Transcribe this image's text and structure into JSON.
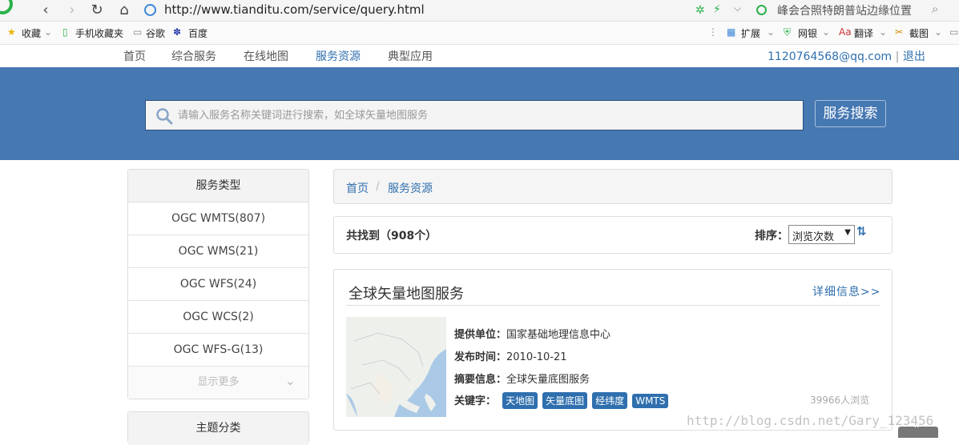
{
  "browser": {
    "url": "http://www.tianditu.com/service/query.html",
    "search_hint": "峰会合照特朗普站边缘位置",
    "bookmarks": [
      "收藏",
      "手机收藏夹",
      "谷歌",
      "百度"
    ],
    "tools": [
      "扩展",
      "网银",
      "翻译",
      "截图"
    ]
  },
  "site_nav": {
    "items": [
      "首页",
      "综合服务",
      "在线地图",
      "服务资源",
      "典型应用"
    ],
    "active": "服务资源",
    "account_email": "1120764568@qq.com",
    "separator": "|",
    "logout": "退出"
  },
  "search": {
    "placeholder": "请输入服务名称关键词进行搜索，如全球矢量地图服务",
    "button": "服务搜索"
  },
  "sidebar": {
    "service_types_title": "服务类型",
    "service_types": [
      "OGC WMTS(807)",
      "OGC WMS(21)",
      "OGC WFS(24)",
      "OGC WCS(2)",
      "OGC WFS-G(13)"
    ],
    "show_more": "显示更多",
    "topic_title": "主题分类"
  },
  "breadcrumb": {
    "home": "首页",
    "sep": "/",
    "current": "服务资源"
  },
  "results": {
    "found_label": "共找到（908个）",
    "sort_label": "排序：",
    "sort_value": "浏览次数"
  },
  "card": {
    "title": "全球矢量地图服务",
    "detail_link": "详细信息>>",
    "provider_label": "提供单位：",
    "provider": "国家基础地理信息中心",
    "date_label": "发布时间：",
    "date": "2010-10-21",
    "summary_label": "摘要信息：",
    "summary": "全球矢量底图服务",
    "keywords_label": "关键字：",
    "keywords": [
      "天地图",
      "矢量底图",
      "经纬度",
      "WMTS"
    ],
    "views": "39966人浏览"
  },
  "watermark": "http://blog.csdn.net/Gary_123456",
  "colors": {
    "brand_blue": "#4678b2",
    "link_blue": "#2f6fae",
    "keyword_bg": "#2f6fae"
  }
}
